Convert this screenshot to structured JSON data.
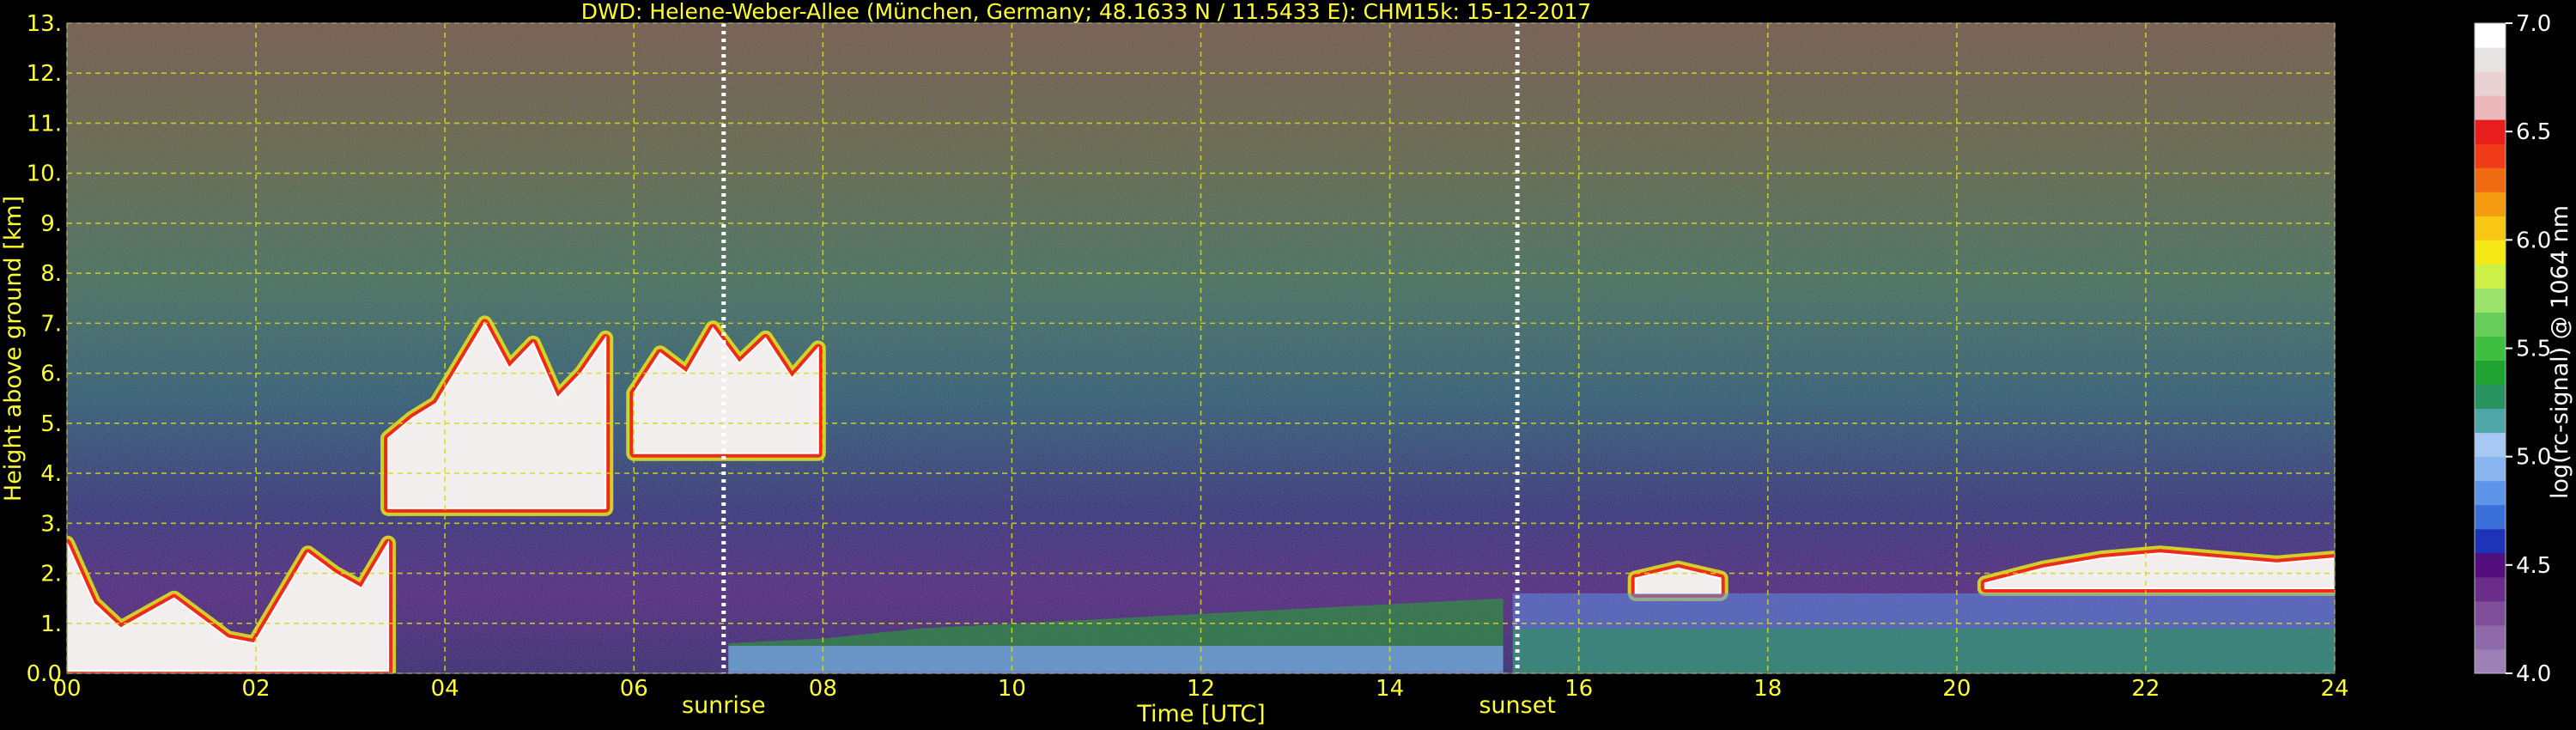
{
  "chart_data": {
    "type": "heatmap",
    "title": "DWD: Helene-Weber-Allee (München, Germany; 48.1633 N / 11.5433 E):    CHM15k: 15-12-2017",
    "xlabel": "Time [UTC]",
    "ylabel": "Height above ground [km]",
    "xlim": [
      0,
      24
    ],
    "ylim": [
      0,
      13
    ],
    "x_ticks": [
      "00",
      "02",
      "04",
      "06",
      "08",
      "10",
      "12",
      "14",
      "16",
      "18",
      "20",
      "22",
      "24"
    ],
    "y_ticks": [
      "0.0",
      "1.",
      "2.",
      "3.",
      "4.",
      "5.",
      "6.",
      "7.",
      "8.",
      "9.",
      "10.",
      "11.",
      "12.",
      "13."
    ],
    "grid": true,
    "events": [
      {
        "label": "sunrise",
        "time": 6.95
      },
      {
        "label": "sunset",
        "time": 15.35
      }
    ],
    "colorbar": {
      "label": "log(rc-signal) @ 1064 nm",
      "range": [
        4.0,
        7.0
      ],
      "ticks": [
        "4.0",
        "4.5",
        "5.0",
        "5.5",
        "6.0",
        "6.5",
        "7.0"
      ],
      "colors": [
        "#9c80b6",
        "#8f6aa9",
        "#7e4e98",
        "#6a2d8a",
        "#520e7c",
        "#1f33b8",
        "#3a6fd8",
        "#5d96e8",
        "#88b4f0",
        "#a8c8f4",
        "#4fa7a7",
        "#2a9460",
        "#1fa333",
        "#3fbf3f",
        "#66cc5a",
        "#9be36b",
        "#cdf047",
        "#f5ea16",
        "#f8c714",
        "#f49b11",
        "#f06a12",
        "#ef3b17",
        "#e81d1d",
        "#ebb9b9",
        "#ebd2d2",
        "#e8e4e4",
        "#ffffff"
      ]
    },
    "layers": [
      {
        "name": "boundary_layer_night",
        "start": 0.0,
        "end": 3.4,
        "top_km": [
          2.6,
          1.4,
          0.9,
          1.2,
          1.5,
          1.1,
          0.7,
          0.6,
          1.5,
          2.4,
          2.0,
          1.7,
          2.6
        ],
        "level": "saturated"
      },
      {
        "name": "cloud_morning",
        "start": 3.4,
        "end": 5.7,
        "base_km": 3.3,
        "top_km": [
          4.7,
          5.1,
          5.4,
          6.2,
          7.0,
          6.1,
          6.6,
          5.5,
          6.0,
          6.7
        ],
        "level": "saturated"
      },
      {
        "name": "cloud_sunrise",
        "start": 6.0,
        "end": 7.95,
        "base_km": 4.4,
        "top_km": [
          5.6,
          6.4,
          6.0,
          6.9,
          6.2,
          6.7,
          5.9,
          6.5
        ],
        "level": "saturated"
      },
      {
        "name": "aerosol_day",
        "start": 7.0,
        "end": 15.2,
        "top_km": [
          0.6,
          0.7,
          0.9,
          1.0,
          1.1,
          1.2,
          1.3,
          1.4,
          1.5
        ],
        "level": "aerosol"
      },
      {
        "name": "cloud_afternoon",
        "start": 16.6,
        "end": 17.5,
        "base_km": 1.6,
        "top_km": [
          1.9,
          2.1,
          1.9
        ],
        "level": "saturated"
      },
      {
        "name": "cloud_evening",
        "start": 20.3,
        "end": 24.0,
        "base_km": 1.7,
        "top_km": [
          1.8,
          2.1,
          2.3,
          2.4,
          2.3,
          2.2,
          2.3
        ],
        "level": "saturated"
      }
    ]
  }
}
